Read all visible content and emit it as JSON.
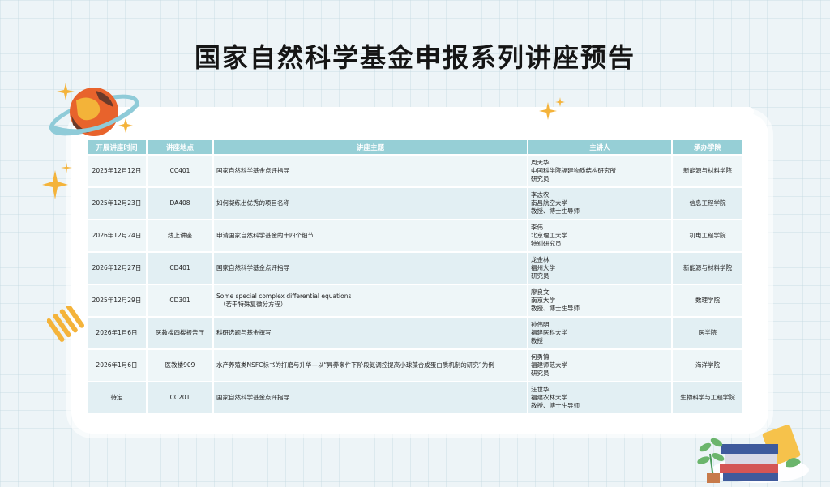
{
  "page": {
    "title": "国家自然科学基金申报系列讲座预告"
  },
  "table": {
    "headers": [
      "开展讲座时间",
      "讲座地点",
      "讲座主题",
      "主讲人",
      "承办学院"
    ],
    "rows": [
      {
        "date": "2025年12月12日",
        "venue": "CC401",
        "topic": "国家自然科学基金点评指导",
        "topic_sub": "",
        "speaker": [
          "周天华",
          "中国科学院福建物质结构研究所",
          "研究员"
        ],
        "college": "新能源与材料学院"
      },
      {
        "date": "2025年12月23日",
        "venue": "DA408",
        "topic": "如何凝练出优秀的项目名称",
        "topic_sub": "",
        "speaker": [
          "李志农",
          "南昌航空大学",
          "教授、博士生导师"
        ],
        "college": "信息工程学院"
      },
      {
        "date": "2026年12月24日",
        "venue": "线上讲座",
        "topic": "申请国家自然科学基金的十四个细节",
        "topic_sub": "",
        "speaker": [
          "李伟",
          "北京理工大学",
          "特别研究员"
        ],
        "college": "机电工程学院"
      },
      {
        "date": "2026年12月27日",
        "venue": "CD401",
        "topic": "国家自然科学基金点评指导",
        "topic_sub": "",
        "speaker": [
          "龙金林",
          "福州大学",
          "研究员"
        ],
        "college": "新能源与材料学院"
      },
      {
        "date": "2025年12月29日",
        "venue": "CD301",
        "topic": "Some special complex differential equations",
        "topic_sub": "（若干特殊复微分方程）",
        "speaker": [
          "廖良文",
          "南京大学",
          "教授、博士生导师"
        ],
        "college": "数理学院"
      },
      {
        "date": "2026年1月6日",
        "venue": "医教楼四楼报告厅",
        "topic": "科研选题与基金撰写",
        "topic_sub": "",
        "speaker": [
          "孙伟明",
          "福建医科大学",
          "教授"
        ],
        "college": "医学院"
      },
      {
        "date": "2026年1月6日",
        "venue": "医教楼909",
        "topic": "水产养殖类NSFC标书的打磨与升华—以“异养条件下阶段氮调控提高小球藻合成蛋白质机制的研究”为例",
        "topic_sub": "",
        "speaker": [
          "何勇锦",
          "福建师范大学",
          "研究员"
        ],
        "college": "海洋学院"
      },
      {
        "date": "待定",
        "venue": "CC201",
        "topic": "国家自然科学基金点评指导",
        "topic_sub": "",
        "speaker": [
          "汪世华",
          "福建农林大学",
          "教授、博士生导师"
        ],
        "college": "生物科学与工程学院"
      }
    ]
  },
  "colors": {
    "header_bg": "#96cfd6",
    "row_bg": "#eef6f8",
    "planet": "#e8632c",
    "star": "#f4b33a"
  }
}
